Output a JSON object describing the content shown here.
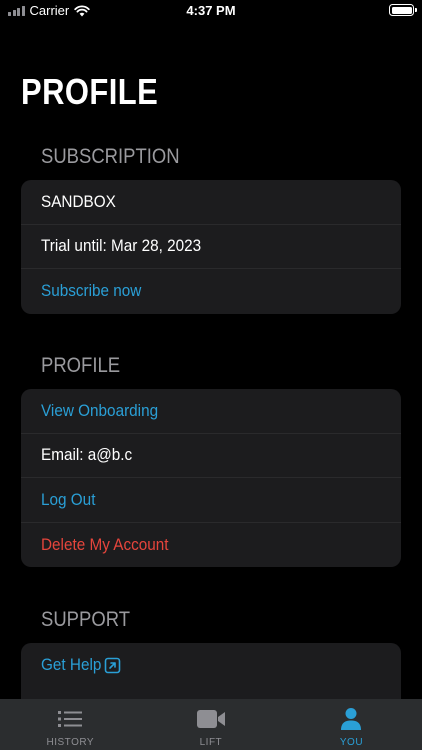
{
  "status_bar": {
    "carrier": "Carrier",
    "time": "4:37 PM"
  },
  "page": {
    "title": "PROFILE"
  },
  "subscription": {
    "header": "SUBSCRIPTION",
    "plan": "SANDBOX",
    "trial": "Trial until: Mar 28, 2023",
    "subscribe_label": "Subscribe now"
  },
  "profile": {
    "header": "PROFILE",
    "view_onboarding": "View Onboarding",
    "email": "Email: a@b.c",
    "log_out": "Log Out",
    "delete_account": "Delete My Account"
  },
  "support": {
    "header": "SUPPORT",
    "get_help": "Get Help"
  },
  "tab_bar": {
    "history": "HISTORY",
    "lift": "LIFT",
    "you": "YOU"
  },
  "colors": {
    "accent": "#2a9fd6",
    "danger": "#e5453c",
    "card": "#1c1c1e",
    "tab_bar": "#2b2d2f"
  }
}
